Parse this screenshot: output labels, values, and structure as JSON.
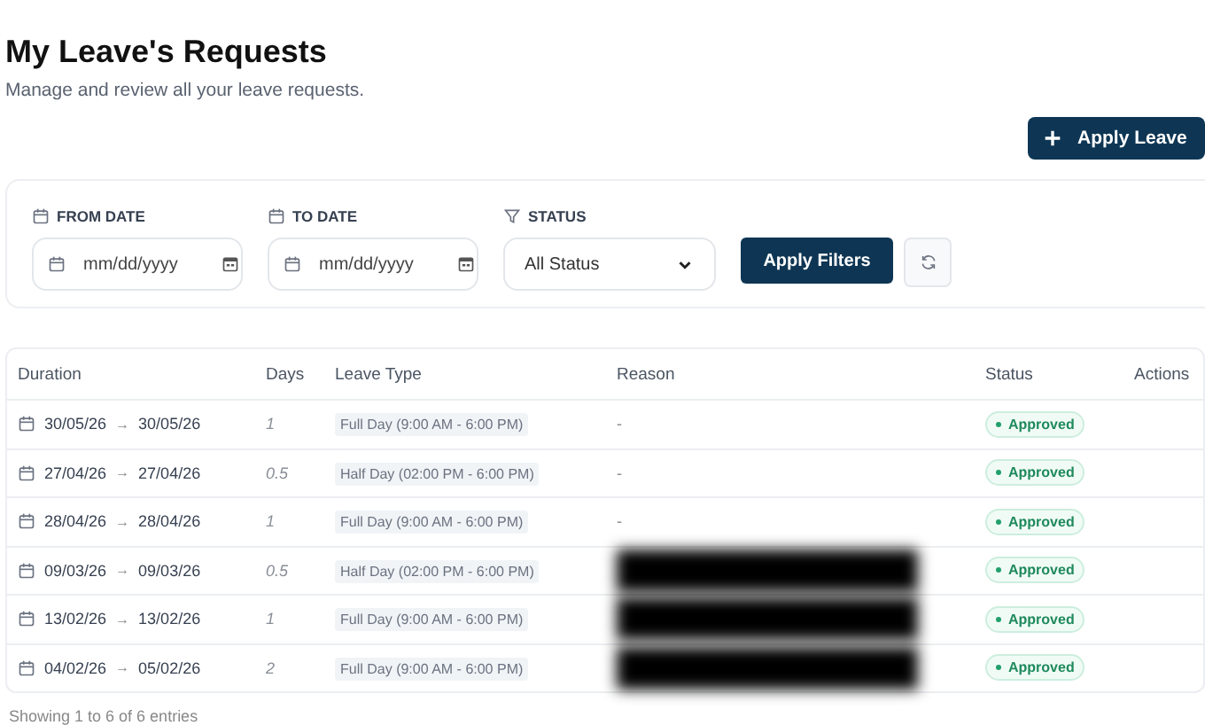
{
  "header": {
    "title": "My Leave's Requests",
    "subtitle": "Manage and review all your leave requests.",
    "action": "Apply Leave"
  },
  "filters": {
    "from_label": "FROM DATE",
    "from_placeholder": "mm/dd/yyyy",
    "to_label": "TO DATE",
    "to_placeholder": "mm/dd/yyyy",
    "status_label": "STATUS",
    "status_value": "All Status",
    "apply": "Apply Filters"
  },
  "table": {
    "columns": [
      "Duration",
      "Days",
      "Leave Type",
      "Reason",
      "Status",
      "Actions"
    ],
    "rows": [
      {
        "from": "30/05/26",
        "arrow": "→",
        "to": "30/05/26",
        "days": "1",
        "type": "Full Day (9:00 AM - 6:00 PM)",
        "reason": "-",
        "redacted": false,
        "status": "Approved"
      },
      {
        "from": "27/04/26",
        "arrow": "→",
        "to": "27/04/26",
        "days": "0.5",
        "type": "Half Day (02:00 PM - 6:00 PM)",
        "reason": "-",
        "redacted": false,
        "status": "Approved"
      },
      {
        "from": "28/04/26",
        "arrow": "→",
        "to": "28/04/26",
        "days": "1",
        "type": "Full Day (9:00 AM - 6:00 PM)",
        "reason": "-",
        "redacted": false,
        "status": "Approved"
      },
      {
        "from": "09/03/26",
        "arrow": "→",
        "to": "09/03/26",
        "days": "0.5",
        "type": "Half Day (02:00 PM - 6:00 PM)",
        "redacted": true,
        "status": "Approved"
      },
      {
        "from": "13/02/26",
        "arrow": "→",
        "to": "13/02/26",
        "days": "1",
        "type": "Full Day (9:00 AM - 6:00 PM)",
        "redacted": true,
        "status": "Approved"
      },
      {
        "from": "04/02/26",
        "arrow": "→",
        "to": "05/02/26",
        "days": "2",
        "type": "Full Day (9:00 AM - 6:00 PM)",
        "redacted": true,
        "status": "Approved"
      }
    ]
  },
  "footer": "Showing 1 to 6 of 6 entries"
}
